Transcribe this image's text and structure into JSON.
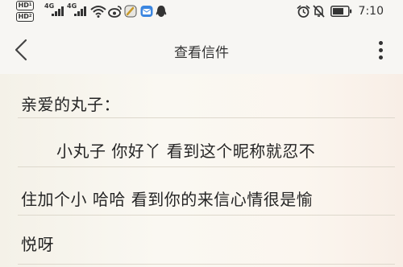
{
  "status_bar": {
    "sim_badges": [
      "HD",
      "HD"
    ],
    "sim_subscripts": [
      "1",
      "2"
    ],
    "networks": [
      "4G",
      "4G"
    ],
    "time": "7:10",
    "icons": [
      "signal-bars",
      "wifi-icon",
      "weibo-icon",
      "edit-app-icon",
      "mail-app-icon",
      "qq-icon",
      "alarm-icon",
      "mute-icon",
      "battery-icon"
    ]
  },
  "header": {
    "title": "查看信件",
    "back_icon": "chevron-left-icon",
    "more_icon": "more-vertical-icon"
  },
  "letter": {
    "greeting": "亲爱的丸子：",
    "lines": [
      "小丸子 你好丫 看到这个昵称就忍不",
      "住加个小 哈哈 看到你的来信心情很是愉",
      "悦呀"
    ]
  }
}
